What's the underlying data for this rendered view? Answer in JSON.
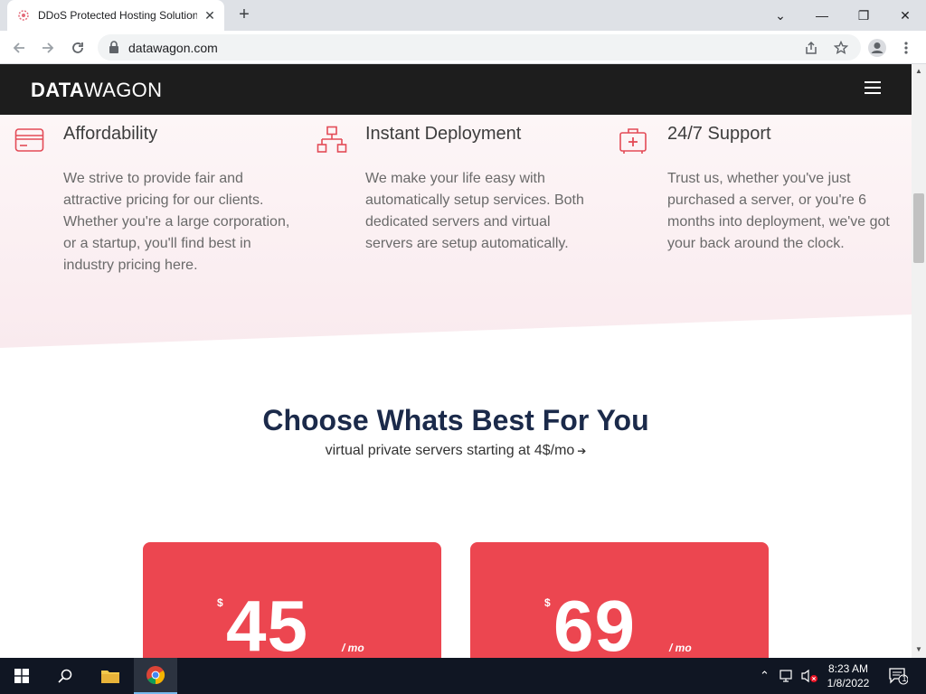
{
  "browser": {
    "tab_title": "DDoS Protected Hosting Solutions",
    "tab_close": "✕",
    "new_tab": "+",
    "url": "datawagon.com",
    "window_controls": {
      "collapse": "⌄",
      "minimize": "—",
      "restore": "❐",
      "close": "✕"
    }
  },
  "site": {
    "logo_bold": "DATA",
    "logo_light": "WAGON",
    "features": [
      {
        "icon": "credit-card-icon",
        "title": "Affordability",
        "text": "We strive to provide fair and attractive pricing for our clients. Whether you're a large corporation, or a startup, you'll find best in industry pricing here."
      },
      {
        "icon": "network-icon",
        "title": "Instant Deployment",
        "text": "We make your life easy with automatically setup services. Both dedicated servers and virtual servers are setup automatically."
      },
      {
        "icon": "medical-kit-icon",
        "title": "24/7 Support",
        "text": "Trust us, whether you've just purchased a server, or you're 6 months into deployment, we've got your back around the clock."
      }
    ],
    "pricing": {
      "title": "Choose Whats Best For You",
      "subtitle": "virtual private servers starting at 4$/mo",
      "arrow": "➔",
      "plans": [
        {
          "currency": "$",
          "price": "45",
          "period": "/ mo"
        },
        {
          "currency": "$",
          "price": "69",
          "period": "/ mo"
        }
      ]
    }
  },
  "taskbar": {
    "time": "8:23 AM",
    "date": "1/8/2022",
    "notifications": "1"
  },
  "colors": {
    "brand_red": "#ec4650",
    "nav_dark": "#1d1d1d",
    "heading_navy": "#1b2a4a"
  }
}
